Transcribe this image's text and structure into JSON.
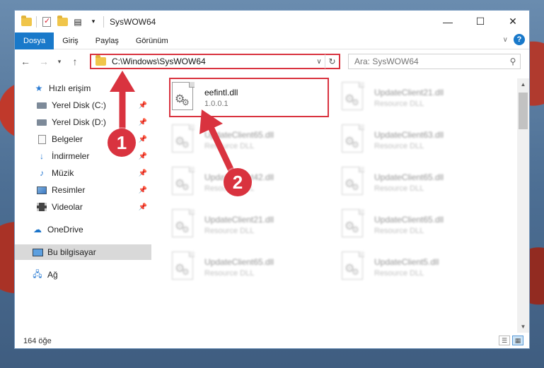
{
  "window": {
    "title": "SysWOW64",
    "controls": {
      "minimize": "—",
      "maximize": "☐",
      "close": "✕"
    }
  },
  "ribbon": {
    "tabs": [
      {
        "label": "Dosya",
        "active": true
      },
      {
        "label": "Giriş",
        "active": false
      },
      {
        "label": "Paylaş",
        "active": false
      },
      {
        "label": "Görünüm",
        "active": false
      }
    ],
    "help": "?"
  },
  "nav": {
    "address": "C:\\Windows\\SysWOW64",
    "search_placeholder": "Ara: SysWOW64"
  },
  "sidebar": {
    "items": [
      {
        "label": "Hızlı erişim",
        "icon": "star-icon",
        "pinned": false
      },
      {
        "label": "Yerel Disk (C:)",
        "icon": "drive-icon",
        "pinned": true
      },
      {
        "label": "Yerel Disk (D:)",
        "icon": "drive-icon",
        "pinned": true
      },
      {
        "label": "Belgeler",
        "icon": "documents-icon",
        "pinned": true
      },
      {
        "label": "İndirmeler",
        "icon": "downloads-icon",
        "pinned": true
      },
      {
        "label": "Müzik",
        "icon": "music-icon",
        "pinned": true
      },
      {
        "label": "Resimler",
        "icon": "pictures-icon",
        "pinned": true
      },
      {
        "label": "Videolar",
        "icon": "videos-icon",
        "pinned": true
      },
      {
        "label": "OneDrive",
        "icon": "onedrive-icon",
        "pinned": false
      },
      {
        "label": "Bu bilgisayar",
        "icon": "computer-icon",
        "pinned": false,
        "selected": true
      },
      {
        "label": "Ağ",
        "icon": "network-icon",
        "pinned": false
      }
    ]
  },
  "files": [
    {
      "name": "eefintl.dll",
      "sub": "1.0.0.1",
      "highlighted": true
    },
    {
      "name": "UpdateClient21.dll",
      "sub": "Resource DLL"
    },
    {
      "name": "UpdateClient65.dll",
      "sub": "Resource DLL"
    },
    {
      "name": "UpdateClient63.dll",
      "sub": "Resource DLL"
    },
    {
      "name": "UpdateClient42.dll",
      "sub": "Resource DLL"
    },
    {
      "name": "UpdateClient65.dll",
      "sub": "Resource DLL"
    },
    {
      "name": "UpdateClient21.dll",
      "sub": "Resource DLL"
    },
    {
      "name": "UpdateClient65.dll",
      "sub": "Resource DLL"
    },
    {
      "name": "UpdateClient65.dll",
      "sub": "Resource DLL"
    },
    {
      "name": "UpdateClient5.dll",
      "sub": "Resource DLL"
    }
  ],
  "status": {
    "count": "164 öğe"
  },
  "annotations": {
    "step1": "1",
    "step2": "2",
    "color": "#d9333f"
  }
}
